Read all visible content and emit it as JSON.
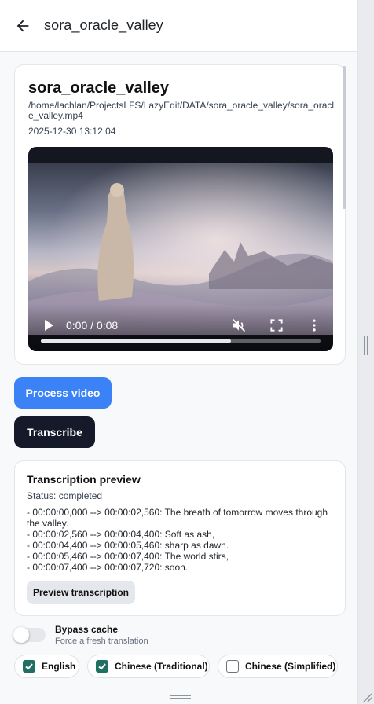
{
  "header": {
    "title": "sora_oracle_valley",
    "back_icon": "arrow-left-icon"
  },
  "video": {
    "title": "sora_oracle_valley",
    "path": "/home/lachlan/ProjectsLFS/LazyEdit/DATA/sora_oracle_valley/sora_oracle_valley.mp4",
    "date": "2025-12-30 13:12:04",
    "time_display": "0:00 / 0:08",
    "progress": 0.68,
    "icons": [
      "play-icon",
      "muted-icon",
      "fullscreen-icon",
      "more-vertical-icon"
    ]
  },
  "actions": {
    "process_label": "Process video",
    "transcribe_label": "Transcribe"
  },
  "transcription": {
    "title": "Transcription preview",
    "status": "Status: completed",
    "lines": [
      "- 00:00:00,000 --> 00:00:02,560: The breath of tomorrow moves through the valley.",
      "- 00:00:02,560 --> 00:00:04,400: Soft as ash,",
      "- 00:00:04,400 --> 00:00:05,460: sharp as dawn.",
      "- 00:00:05,460 --> 00:00:07,400: The world stirs,",
      "- 00:00:07,400 --> 00:00:07,720: soon."
    ],
    "preview_button": "Preview transcription"
  },
  "bypass": {
    "label": "Bypass cache",
    "sublabel": "Force a fresh translation",
    "enabled": false
  },
  "languages": [
    {
      "label": "English",
      "checked": true
    },
    {
      "label": "Chinese (Traditional)",
      "checked": true
    },
    {
      "label": "Chinese (Simplified)",
      "checked": false
    }
  ],
  "colors": {
    "primary": "#3b82f6",
    "dark_button": "#141a2a",
    "checkbox": "#1f6f62"
  }
}
